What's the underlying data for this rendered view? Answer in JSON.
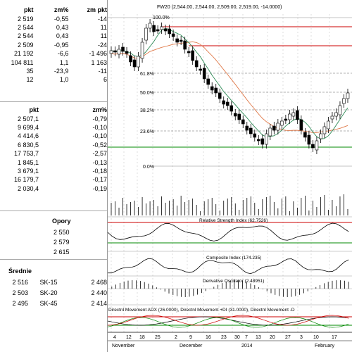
{
  "quotes_table": {
    "headers": [
      "pkt",
      "zm%",
      "zm pkt"
    ],
    "rows": [
      [
        "2 519",
        "-0,55",
        "-14"
      ],
      [
        "2 544",
        "0,43",
        "11"
      ],
      [
        "2 544",
        "0,43",
        "11"
      ],
      [
        "2 509",
        "-0,95",
        "-24"
      ],
      [
        "21 192",
        "-6,6",
        "-1 496"
      ],
      [
        "104 811",
        "1,1",
        "1 163"
      ],
      [
        "35",
        "-23,9",
        "-11"
      ],
      [
        "12",
        "1,0",
        "6"
      ]
    ]
  },
  "index_table": {
    "headers": [
      "pkt",
      "zm%"
    ],
    "rows": [
      [
        "2 507,1",
        "-0,79"
      ],
      [
        "9 699,4",
        "-0,10"
      ],
      [
        "4 414,6",
        "-0,10"
      ],
      [
        "6 830,5",
        "-0,52"
      ],
      [
        "17 753,7",
        "-2,57"
      ],
      [
        "1 845,1",
        "-0,13"
      ],
      [
        "3 679,1",
        "-0,18"
      ],
      [
        "16 179,7",
        "-0,17"
      ],
      [
        "2 030,4",
        "-0,19"
      ]
    ]
  },
  "opory": {
    "title": "Opory",
    "values": [
      "2 550",
      "2 579",
      "2 615"
    ]
  },
  "srednie": {
    "title": "Średnie",
    "rows": [
      [
        "2 516",
        "SK-15",
        "2 468"
      ],
      [
        "2 503",
        "SK-20",
        "2 440"
      ],
      [
        "2 495",
        "SK-45",
        "2 414"
      ]
    ]
  },
  "chart": {
    "title": "FW20 (2,544.00, 2,544.00, 2,509.00, 2,519.00, -14.0000)",
    "fib_levels": [
      "100.0%",
      "61.8%",
      "50.0%",
      "38.2%",
      "23.6%",
      "0.0%"
    ],
    "rsi_label": "Relative Strength Index (62.7526)",
    "composite_label": "Composite Index (174.235)",
    "derivative_label": "Derivative Oscillator (2.48951)",
    "dmi_label": "Directnl Movement ADX (26.0000), Directnl Movement +DI (31.0000), Directnl Movement -D",
    "x_days": [
      "4",
      "12",
      "18",
      "25",
      "2",
      "9",
      "16",
      "23",
      "30",
      "7",
      "13",
      "20",
      "27",
      "3",
      "10",
      "17"
    ],
    "x_months": [
      "November",
      "December",
      "2014",
      "February"
    ],
    "colors": {
      "red": "#cc0000",
      "green": "#008800",
      "ma": "#e07a4a",
      "ma2": "#2e8b57"
    }
  }
}
